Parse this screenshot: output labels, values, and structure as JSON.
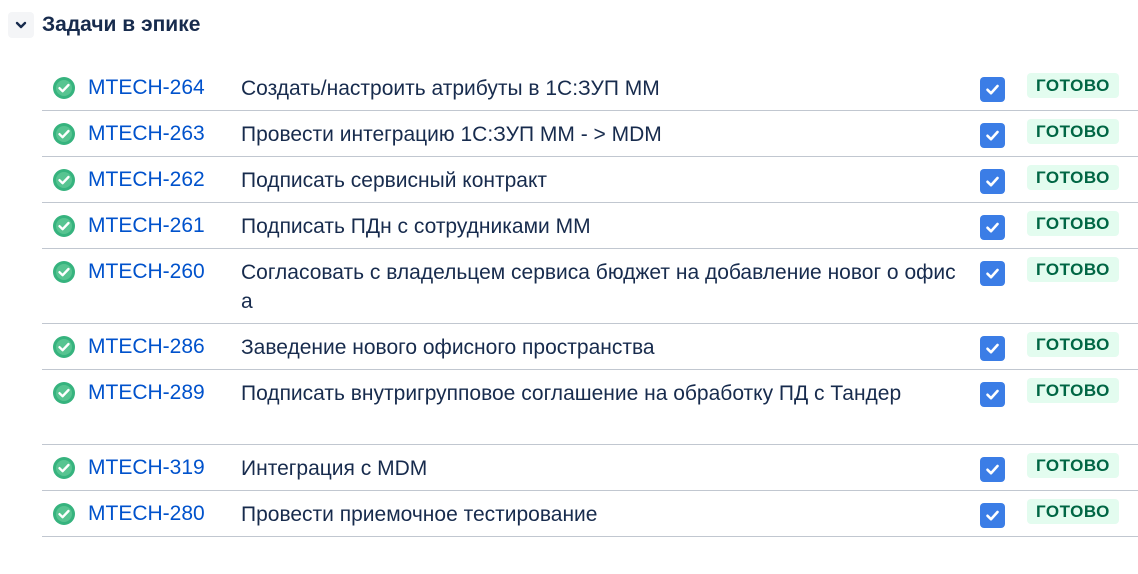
{
  "section": {
    "title": "Задачи в эпике"
  },
  "colors": {
    "link": "#0052cc",
    "status_done_bg": "#e3fcef",
    "status_done_text": "#006644",
    "checkbox": "#3b7de6",
    "done_icon": "#36b37e"
  },
  "issues": [
    {
      "key": "MTECH-264",
      "summary": "Создать/настроить атрибуты в 1С:ЗУП ММ",
      "done": true,
      "status": "ГОТОВО",
      "icon": "check-circle-icon"
    },
    {
      "key": "MTECH-263",
      "summary": "Провести интеграцию 1С:ЗУП ММ - > MDM",
      "done": true,
      "status": "ГОТОВО",
      "icon": "check-circle-icon"
    },
    {
      "key": "MTECH-262",
      "summary": "Подписать сервисный контракт",
      "done": true,
      "status": "ГОТОВО",
      "icon": "check-circle-icon"
    },
    {
      "key": "MTECH-261",
      "summary": "Подписать ПДн с сотрудниками ММ",
      "done": true,
      "status": "ГОТОВО",
      "icon": "check-circle-icon"
    },
    {
      "key": "MTECH-260",
      "summary": "Согласовать с владельцем сервиса бюджет на добавление новог о офиса",
      "done": true,
      "status": "ГОТОВО",
      "icon": "check-circle-icon"
    },
    {
      "key": "MTECH-286",
      "summary": "Заведение нового офисного пространства",
      "done": true,
      "status": "ГОТОВО",
      "icon": "check-circle-icon"
    },
    {
      "key": "MTECH-289",
      "summary": "Подписать внутригрупповое соглашение на обработку ПД с Тандер",
      "done": true,
      "status": "ГОТОВО",
      "icon": "check-circle-icon"
    },
    {
      "key": "MTECH-319",
      "summary": "Интеграция с MDM",
      "done": true,
      "status": "ГОТОВО",
      "icon": "check-circle-icon"
    },
    {
      "key": "MTECH-280",
      "summary": "Провести приемочное тестирование",
      "done": true,
      "status": "ГОТОВО",
      "icon": "check-circle-icon"
    }
  ]
}
